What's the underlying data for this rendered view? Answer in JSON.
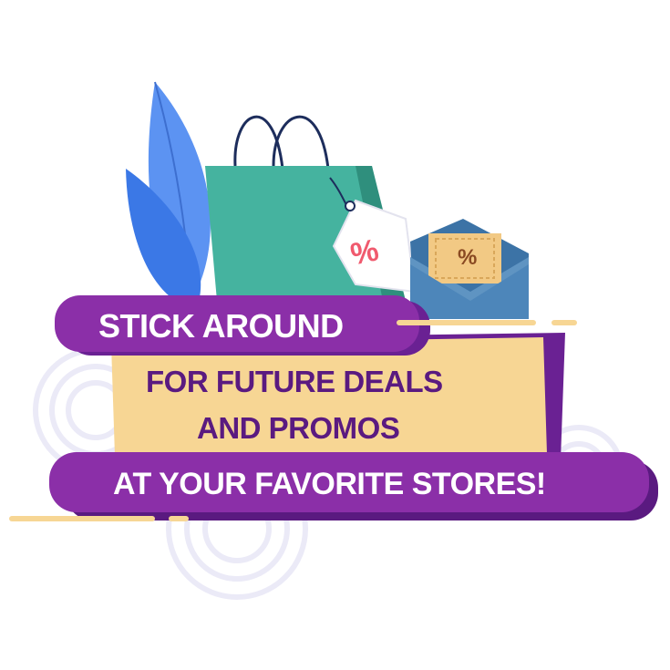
{
  "banner": {
    "line1": "STICK AROUND",
    "line2": "FOR FUTURE DEALS",
    "line3": "AND PROMOS",
    "line4": "AT YOUR FAVORITE STORES!"
  },
  "price_tag": {
    "symbol": "%"
  },
  "coupon": {
    "symbol": "%"
  },
  "colors": {
    "purple": "#8b2fa8",
    "purple_dark": "#5a1a80",
    "cream": "#f7d694",
    "bag": "#45b39f",
    "bag_dark": "#2f8f7d",
    "leaf_blue": "#4a86f0",
    "envelope": "#4a86b0",
    "ring": "#ebeaf7",
    "tag_text": "#f05a6e"
  },
  "icons": [
    "leaf-icon",
    "shopping-bag-icon",
    "price-tag-icon",
    "envelope-icon",
    "coupon-icon"
  ]
}
